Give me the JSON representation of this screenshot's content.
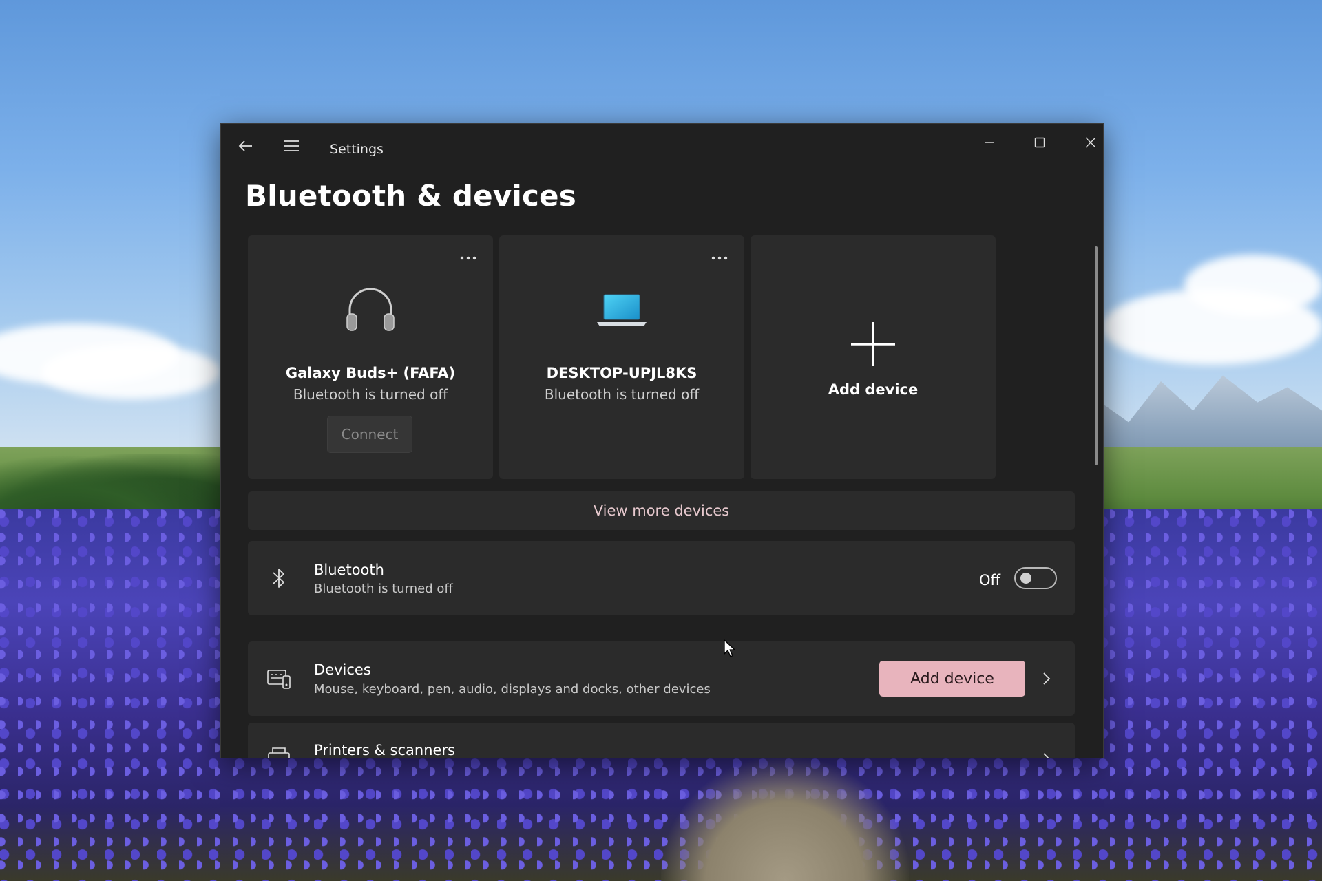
{
  "window": {
    "app_title": "Settings",
    "page_title": "Bluetooth & devices"
  },
  "device_cards": [
    {
      "name": "Galaxy Buds+ (FAFA)",
      "status": "Bluetooth is turned off",
      "icon": "headphones-icon",
      "action_label": "Connect"
    },
    {
      "name": "DESKTOP-UPJL8KS",
      "status": "Bluetooth is turned off",
      "icon": "laptop-icon"
    }
  ],
  "add_card": {
    "label": "Add device",
    "icon": "plus-icon"
  },
  "view_more": {
    "label": "View more devices"
  },
  "bluetooth_row": {
    "title": "Bluetooth",
    "subtitle": "Bluetooth is turned off",
    "toggle_label": "Off",
    "toggle_on": false,
    "icon": "bluetooth-icon"
  },
  "devices_row": {
    "title": "Devices",
    "subtitle": "Mouse, keyboard, pen, audio, displays and docks, other devices",
    "button_label": "Add device",
    "icon": "devices-icon"
  },
  "printers_row": {
    "title": "Printers & scanners",
    "icon": "printer-icon"
  },
  "colors": {
    "window_bg": "#202020",
    "card_bg": "#2b2b2b",
    "accent": "#e8b4bd",
    "link_text": "#e6c8cd"
  }
}
